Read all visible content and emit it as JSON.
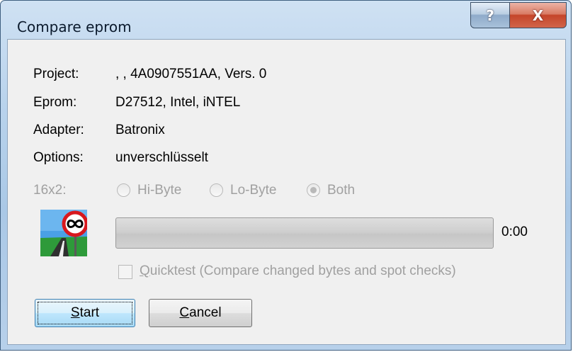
{
  "window": {
    "title": "Compare eprom",
    "help_label": "?",
    "close_label": "X"
  },
  "info": {
    "project_label": "Project:",
    "project_value": ", , 4A0907551AA, Vers. 0",
    "eprom_label": "Eprom:",
    "eprom_value": "D27512, Intel, iNTEL",
    "adapter_label": "Adapter:",
    "adapter_value": "Batronix",
    "options_label": "Options:",
    "options_value": "unverschlüsselt"
  },
  "mode": {
    "label": "16x2:",
    "options": [
      "Hi-Byte",
      "Lo-Byte",
      "Both"
    ],
    "selected": "Both",
    "enabled": false
  },
  "progress": {
    "fraction": 0,
    "time": "0:00"
  },
  "quicktest": {
    "mnemonic": "Q",
    "rest": "uicktest (Compare changed bytes and spot checks)",
    "checked": false,
    "enabled": false
  },
  "buttons": {
    "start_mnemonic": "S",
    "start_rest": "tart",
    "cancel_mnemonic": "C",
    "cancel_rest": "ancel"
  },
  "colors": {
    "disabled_text": "#a0a0a0",
    "sign_red": "#d8181e"
  },
  "icons": {
    "logo": "infinity-road-sign-icon",
    "help": "help-icon",
    "close": "close-icon"
  }
}
